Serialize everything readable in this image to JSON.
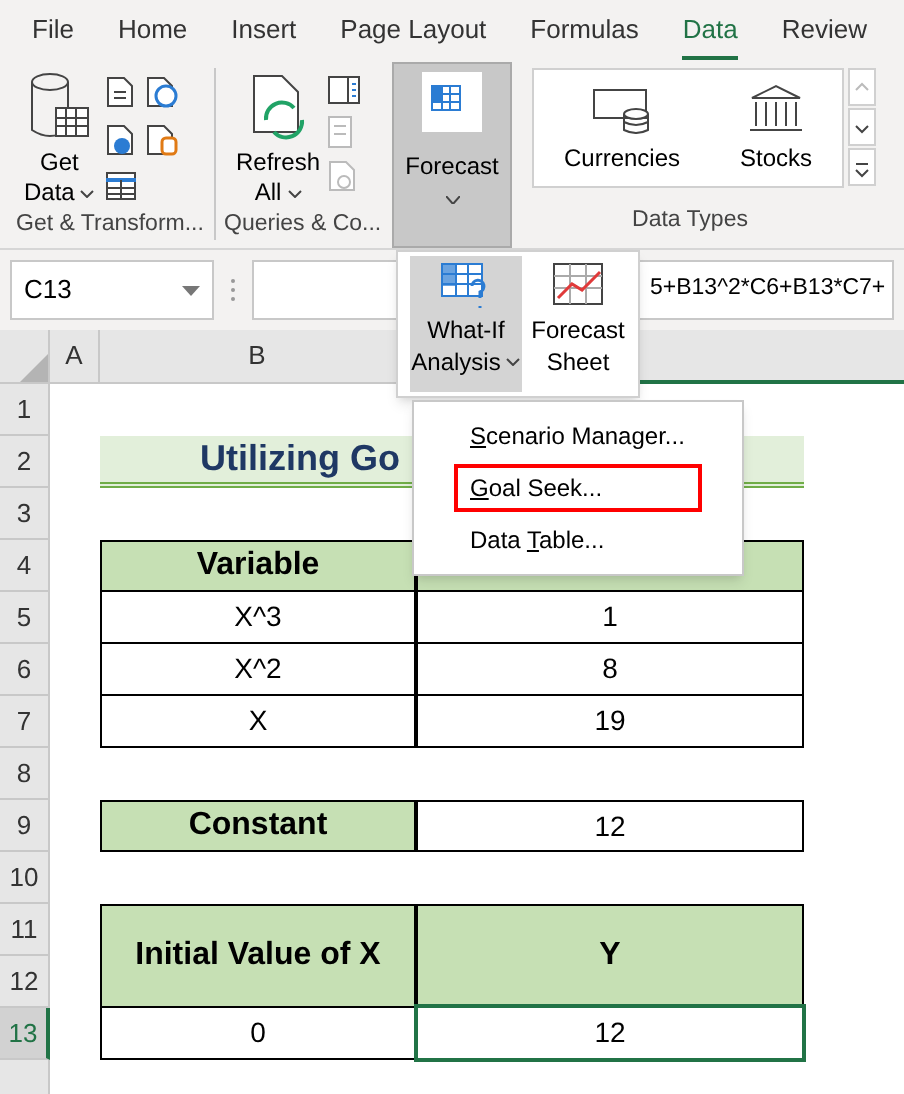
{
  "ribbon_tabs": [
    {
      "label": "File",
      "selected": false
    },
    {
      "label": "Home",
      "selected": false
    },
    {
      "label": "Insert",
      "selected": false
    },
    {
      "label": "Page Layout",
      "selected": false
    },
    {
      "label": "Formulas",
      "selected": false
    },
    {
      "label": "Data",
      "selected": true
    },
    {
      "label": "Review",
      "selected": false
    }
  ],
  "ribbon": {
    "get_data": [
      "Get",
      "Data"
    ],
    "group_1": "Get & Transform...",
    "refresh": [
      "Refresh",
      "All"
    ],
    "group_2": "Queries & Co...",
    "forecast": {
      "label": "Forecast",
      "expanded": true
    },
    "data_types": [
      "Currencies",
      "Stocks"
    ],
    "group_3": "Data Types"
  },
  "formula_bar": {
    "name_box": "C13",
    "formula": "5+B13^2*C6+B13*C7+"
  },
  "forecast_panel": [
    {
      "label": [
        "What-If",
        "Analysis"
      ],
      "selected": true
    },
    {
      "label": [
        "Forecast",
        "Sheet"
      ],
      "selected": false
    }
  ],
  "what_if_menu": [
    {
      "key": "S",
      "rest": "cenario Manager...",
      "highlighted": false
    },
    {
      "key": "G",
      "rest": "oal Seek...",
      "highlighted": true
    },
    {
      "key": "T",
      "rest": "able...",
      "before": "Data ",
      "highlighted": false
    }
  ],
  "sheet": {
    "columns": [
      "A",
      "B"
    ],
    "rows": [
      {
        "label": "1",
        "selected": false
      },
      {
        "label": "2",
        "selected": false
      },
      {
        "label": "3",
        "selected": false
      },
      {
        "label": "4",
        "selected": false
      },
      {
        "label": "5",
        "selected": false
      },
      {
        "label": "6",
        "selected": false
      },
      {
        "label": "7",
        "selected": false
      },
      {
        "label": "8",
        "selected": false
      },
      {
        "label": "9",
        "selected": false
      },
      {
        "label": "10",
        "selected": false
      },
      {
        "label": "11",
        "selected": false
      },
      {
        "label": "12",
        "selected": false
      },
      {
        "label": "13",
        "selected": true
      }
    ],
    "title": "Utilizing Go",
    "coef_header": "Variable",
    "coef_rows": [
      [
        "X^3",
        "1"
      ],
      [
        "X^2",
        "8"
      ],
      [
        "X",
        "19"
      ]
    ],
    "constant": [
      "Constant",
      "12"
    ],
    "result_header": [
      "Initial Value of X",
      "Y"
    ],
    "result_values": [
      "0",
      "12"
    ]
  }
}
